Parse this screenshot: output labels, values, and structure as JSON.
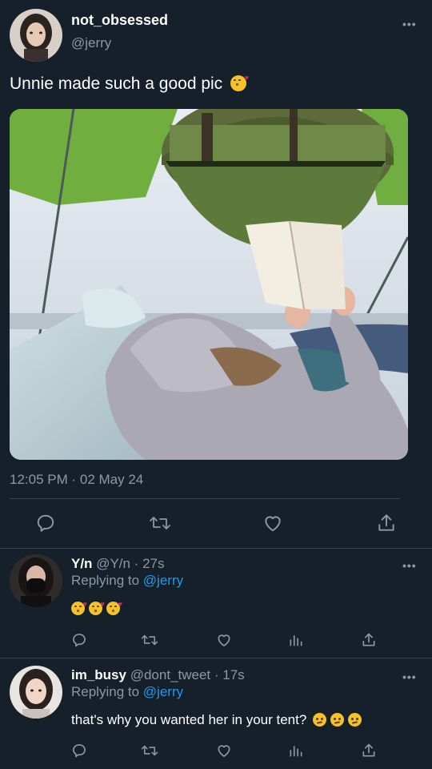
{
  "tweet": {
    "display_name": "not_obsessed",
    "handle": "@jerry",
    "text": "Unnie made such a good pic",
    "text_emoji": "face-blowing-a-kiss",
    "timestamp": "12:05 PM · 02 May 24",
    "more_icon": "more-horizontal-icon"
  },
  "actions": [
    "reply-icon",
    "retweet-icon",
    "like-icon",
    "share-icon"
  ],
  "replies": [
    {
      "display_name": "Y/n",
      "handle_time": "@Y/n · 27s",
      "replying_prefix": "Replying to",
      "replying_handle": "@jerry",
      "text": "",
      "emojis": [
        "face-blowing-a-kiss",
        "face-blowing-a-kiss",
        "face-blowing-a-kiss"
      ]
    },
    {
      "display_name": "im_busy",
      "handle_time": "@dont_tweet · 17s",
      "replying_prefix": "Replying to",
      "replying_handle": "@jerry",
      "text": "that's why you wanted her in your tent?",
      "emojis": [
        "confused-face",
        "confused-face",
        "confused-face"
      ]
    }
  ],
  "reply_actions": [
    "reply-icon",
    "retweet-icon",
    "like-icon",
    "analytics-icon",
    "share-icon"
  ],
  "colors": {
    "background": "#15202b",
    "muted": "#8b98a5",
    "link": "#1d9bf0",
    "divider": "#38444d"
  }
}
